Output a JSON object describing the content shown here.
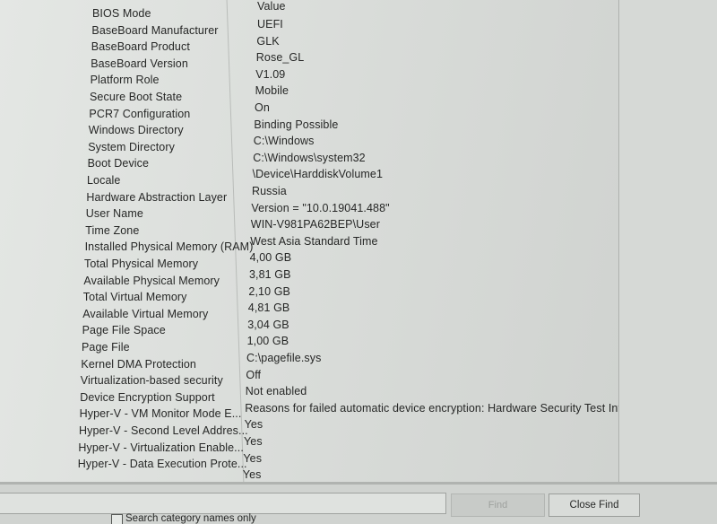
{
  "table": {
    "value_header": "Value",
    "rows": [
      {
        "item": "BIOS Mode",
        "value": "UEFI"
      },
      {
        "item": "BaseBoard Manufacturer",
        "value": "GLK"
      },
      {
        "item": "BaseBoard Product",
        "value": "Rose_GL"
      },
      {
        "item": "BaseBoard Version",
        "value": "V1.09"
      },
      {
        "item": "Platform Role",
        "value": "Mobile"
      },
      {
        "item": "Secure Boot State",
        "value": "On"
      },
      {
        "item": "PCR7 Configuration",
        "value": "Binding Possible"
      },
      {
        "item": "Windows Directory",
        "value": "C:\\Windows"
      },
      {
        "item": "System Directory",
        "value": "C:\\Windows\\system32"
      },
      {
        "item": "Boot Device",
        "value": "\\Device\\HarddiskVolume1"
      },
      {
        "item": "Locale",
        "value": "Russia"
      },
      {
        "item": "Hardware Abstraction Layer",
        "value": "Version = \"10.0.19041.488\""
      },
      {
        "item": "User Name",
        "value": "WIN-V981PA62BEP\\User"
      },
      {
        "item": "Time Zone",
        "value": "West Asia Standard Time"
      },
      {
        "item": "Installed Physical Memory (RAM)",
        "value": "4,00 GB"
      },
      {
        "item": "Total Physical Memory",
        "value": "3,81 GB"
      },
      {
        "item": "Available Physical Memory",
        "value": "2,10 GB"
      },
      {
        "item": "Total Virtual Memory",
        "value": "4,81 GB"
      },
      {
        "item": "Available Virtual Memory",
        "value": "3,04 GB"
      },
      {
        "item": "Page File Space",
        "value": "1,00 GB"
      },
      {
        "item": "Page File",
        "value": "C:\\pagefile.sys"
      },
      {
        "item": "Kernel DMA Protection",
        "value": "Off"
      },
      {
        "item": "Virtualization-based security",
        "value": "Not enabled"
      },
      {
        "item": "Device Encryption Support",
        "value": "Reasons for failed automatic device encryption: Hardware Security Test Interfa..."
      },
      {
        "item": "Hyper-V - VM Monitor Mode E...",
        "value": "Yes"
      },
      {
        "item": "Hyper-V - Second Level Addres...",
        "value": "Yes"
      },
      {
        "item": "Hyper-V - Virtualization Enable...",
        "value": "Yes"
      },
      {
        "item": "Hyper-V - Data Execution Prote...",
        "value": "Yes"
      }
    ]
  },
  "find_bar": {
    "find_label": "Find",
    "close_find_label": "Close Find",
    "search_names_label": "Search category names only"
  }
}
